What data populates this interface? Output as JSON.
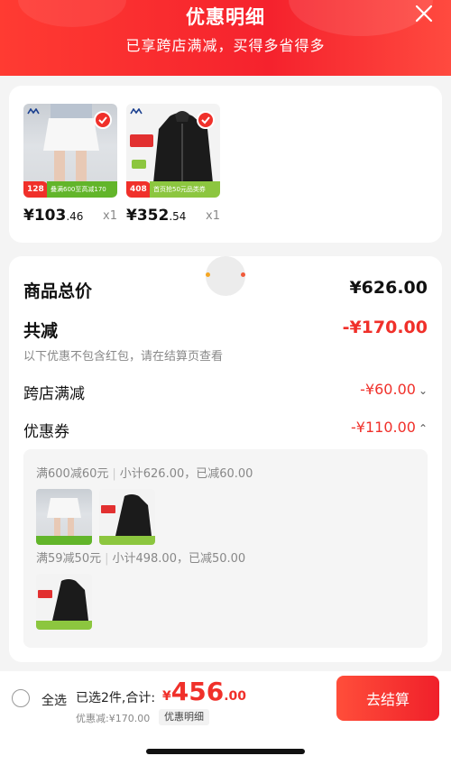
{
  "header": {
    "title": "优惠明细",
    "subtitle": "已享跨店满减，买得多省得多"
  },
  "products": [
    {
      "price_int": "¥103",
      "price_dec": ".46",
      "qty": "x1",
      "tag_price": "128",
      "promo": "叠满600至高减170"
    },
    {
      "price_int": "¥352",
      "price_dec": ".54",
      "qty": "x1",
      "tag_price": "408",
      "promo": "首页抢50元品类券"
    }
  ],
  "summary": {
    "total_label": "商品总价",
    "total_value": "¥626.00",
    "discount_label": "共减",
    "discount_value": "-¥170.00",
    "note": "以下优惠不包含红包，请在结算页查看",
    "cross_store_label": "跨店满减",
    "cross_store_value": "-¥60.00",
    "coupon_label": "优惠券",
    "coupon_value": "-¥110.00"
  },
  "coupon_details": [
    {
      "rule": "满600减60元",
      "subtotal": "小计626.00，已减60.00"
    },
    {
      "rule": "满59减50元",
      "subtotal": "小计498.00，已减50.00"
    }
  ],
  "footer": {
    "select_all": "全选",
    "selected": "已选2件,合计:",
    "currency": "¥",
    "total_int": "456",
    "total_dec": ".00",
    "discount_text": "优惠减:¥170.00",
    "detail_chip": "优惠明细",
    "checkout": "去结算"
  },
  "colors": {
    "accent": "#f0302a",
    "promo_green": "#62b52a"
  }
}
